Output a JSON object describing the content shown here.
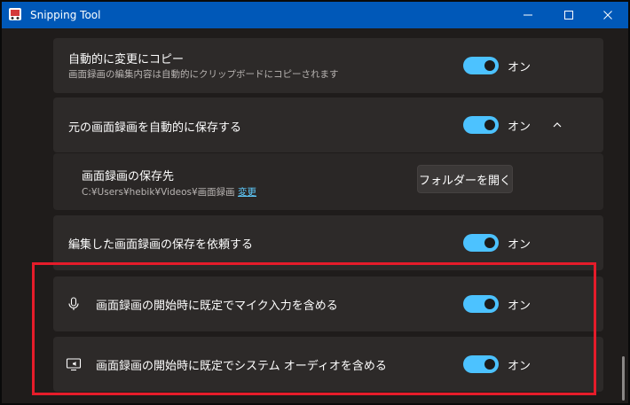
{
  "window": {
    "title": "Snipping Tool",
    "minimize_glyph": "─",
    "maximize_glyph": "☐",
    "close_glyph": "✕"
  },
  "settings": {
    "auto_copy": {
      "title": "自動的に変更にコピー",
      "description": "画面録画の編集内容は自動的にクリップボードにコピーされます",
      "state": "オン"
    },
    "auto_save": {
      "title": "元の画面録画を自動的に保存する",
      "state": "オン"
    },
    "save_location": {
      "title": "画面録画の保存先",
      "path": "C:¥Users¥hebik¥Videos¥画面録画",
      "change_link": "変更",
      "open_folder_button": "フォルダーを開く"
    },
    "ask_save": {
      "title": "編集した画面録画の保存を依頼する",
      "state": "オン"
    },
    "mic_default": {
      "title": "画面録画の開始時に既定でマイク入力を含める",
      "state": "オン",
      "icon": "microphone-icon"
    },
    "system_audio_default": {
      "title": "画面録画の開始時に既定でシステム オーディオを含める",
      "state": "オン",
      "icon": "speaker-monitor-icon"
    }
  },
  "colors": {
    "accent": "#4cc2ff",
    "titlebar": "#0058b8",
    "highlight": "#e51c2a"
  }
}
